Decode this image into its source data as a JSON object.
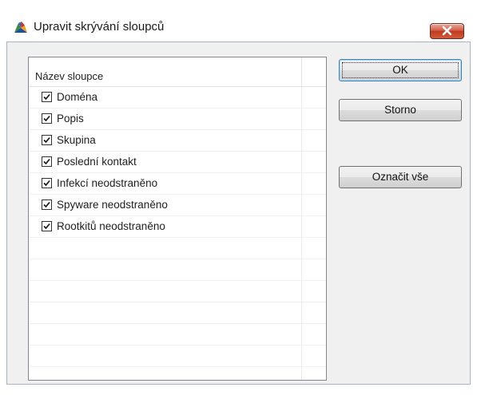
{
  "window": {
    "title": "Upravit skrývání sloupců",
    "close_icon": "close-icon"
  },
  "list": {
    "column_header": "Název sloupce",
    "items": [
      {
        "label": "Doména",
        "checked": true
      },
      {
        "label": "Popis",
        "checked": true
      },
      {
        "label": "Skupina",
        "checked": true
      },
      {
        "label": "Poslední kontakt",
        "checked": true
      },
      {
        "label": "Infekcí neodstraněno",
        "checked": true
      },
      {
        "label": "Spyware neodstraněno",
        "checked": true
      },
      {
        "label": "Rootkitů neodstraněno",
        "checked": true
      }
    ]
  },
  "buttons": {
    "ok_label": "OK",
    "cancel_label": "Storno",
    "select_all_label": "Označit vše"
  },
  "colors": {
    "close_button": "#c2391d",
    "default_button_border": "#3c7fb1"
  }
}
